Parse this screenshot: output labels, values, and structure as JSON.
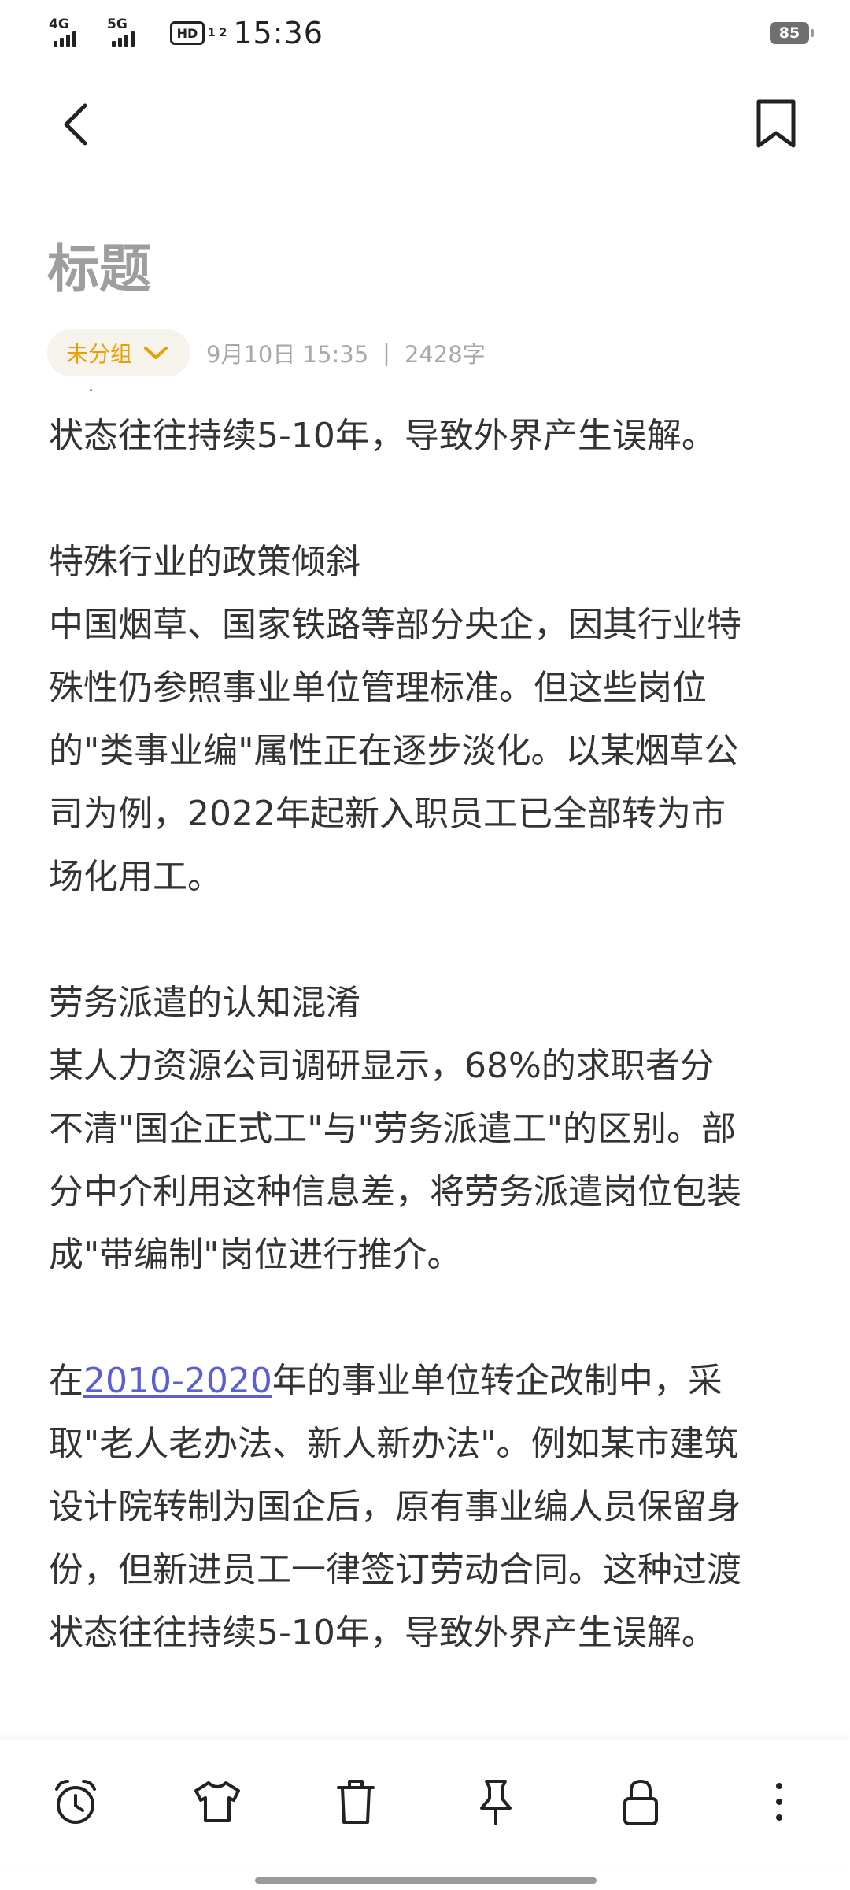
{
  "status_bar": {
    "network_1": "4G",
    "network_2": "5G",
    "hd_label": "HD",
    "hd_sub": "1 2",
    "time": "15:36",
    "battery": "85"
  },
  "top_bar": {
    "back_icon": "chevron-left-icon",
    "bookmark_icon": "bookmark-icon"
  },
  "note": {
    "title": "标题",
    "group_label": "未分组",
    "date": "9月10日 15:35",
    "separator": "|",
    "word_count": "2428字"
  },
  "content": {
    "p1": "状态往往持续5-10年，导致外界产生误解。",
    "h2": "特殊行业的政策倾斜",
    "p2_l1": "中国烟草、国家铁路等部分央企，因其行业特",
    "p2_l2": "殊性仍参照事业单位管理标准。但这些岗位",
    "p2_l3": "的\"类事业编\"属性正在逐步淡化。以某烟草公",
    "p2_l4": "司为例，2022年起新入职员工已全部转为市",
    "p2_l5": "场化用工。",
    "h3": "劳务派遣的认知混淆",
    "p3_l1": "某人力资源公司调研显示，68%的求职者分",
    "p3_l2": "不清\"国企正式工\"与\"劳务派遣工\"的区别。部",
    "p3_l3": "分中介利用这种信息差，将劳务派遣岗位包装",
    "p3_l4": "成\"带编制\"岗位进行推介。",
    "p4_pre": "在",
    "p4_link": "2010-2020",
    "p4_post": "年的事业单位转企改制中，采",
    "p4_l2": "取\"老人老办法、新人新办法\"。例如某市建筑",
    "p4_l3": "设计院转制为国企后，原有事业编人员保留身",
    "p4_l4": "份，但新进员工一律签订劳动合同。这种过渡",
    "p4_l5": "状态往往持续5-10年，导致外界产生误解。"
  },
  "toolbar": {
    "items": [
      "alarm-clock-icon",
      "shirt-icon",
      "trash-icon",
      "pin-icon",
      "lock-icon",
      "more-vertical-icon"
    ]
  },
  "colors": {
    "accent": "#e8a100",
    "link": "#5a5fd6",
    "title_gray": "#9e9e9e"
  }
}
